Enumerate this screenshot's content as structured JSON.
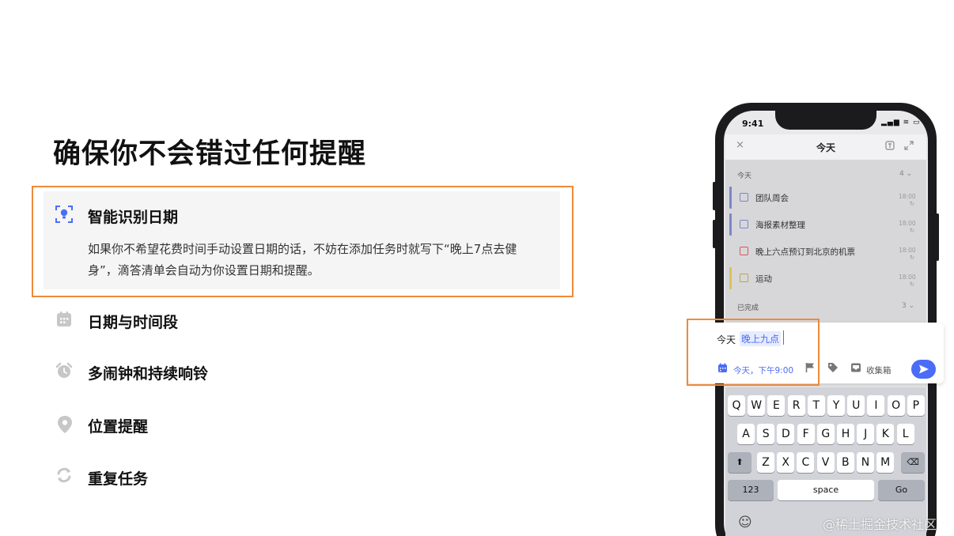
{
  "page": {
    "title": "确保你不会错过任何提醒"
  },
  "features": [
    {
      "title": "智能识别日期",
      "icon": "smart-recognition-icon",
      "description": "如果你不希望花费时间手动设置日期的话，不妨在添加任务时就写下“晚上7点去健身”，滴答清单会自动为你设置日期和提醒。",
      "active": true
    },
    {
      "title": "日期与时间段",
      "icon": "calendar-icon"
    },
    {
      "title": "多闹钟和持续响铃",
      "icon": "alarm-clock-icon"
    },
    {
      "title": "位置提醒",
      "icon": "location-pin-icon"
    },
    {
      "title": "重复任务",
      "icon": "repeat-icon"
    }
  ],
  "phone": {
    "status_time": "9:41",
    "status_icons": "▂▄▆ ≋ ▭",
    "header": {
      "title": "今天",
      "close_icon": "×"
    },
    "today_section": {
      "label": "今天",
      "count": "4 ⌄"
    },
    "tasks": [
      {
        "text": "团队周会",
        "time": "18:00",
        "sub": "↻",
        "bar_color": "#7c86c8"
      },
      {
        "text": "海报素材整理",
        "time": "18:00",
        "sub": "↻",
        "bar_color": "#7c86c8"
      },
      {
        "text": "晚上六点预订到北京的机票",
        "time": "18:00",
        "sub": "↻",
        "bar_color": "#d7d7da",
        "check_color": "#d25a5a"
      },
      {
        "text": "运动",
        "time": "18:00",
        "sub": "↻",
        "bar_color": "#d9c25a",
        "check_color": "#b9a54a"
      }
    ],
    "done_section": {
      "label": "已完成",
      "count": "3 ⌄"
    },
    "input": {
      "prefix": "今天",
      "highlight": "晚上九点",
      "date_chip": "今天，下午9:00",
      "inbox_label": "收集箱"
    },
    "keyboard": {
      "row1": [
        "Q",
        "W",
        "E",
        "R",
        "T",
        "Y",
        "U",
        "I",
        "O",
        "P"
      ],
      "row2": [
        "A",
        "S",
        "D",
        "F",
        "G",
        "H",
        "J",
        "K",
        "L"
      ],
      "row3": [
        "Z",
        "X",
        "C",
        "V",
        "B",
        "N",
        "M"
      ],
      "shift": "⬆",
      "backspace": "⌫",
      "numbers": "123",
      "space": "space",
      "go": "Go"
    }
  },
  "accent_color": "#4b6cf7",
  "highlight_color": "#ee8a3a",
  "watermark": "@稀土掘金技术社区"
}
